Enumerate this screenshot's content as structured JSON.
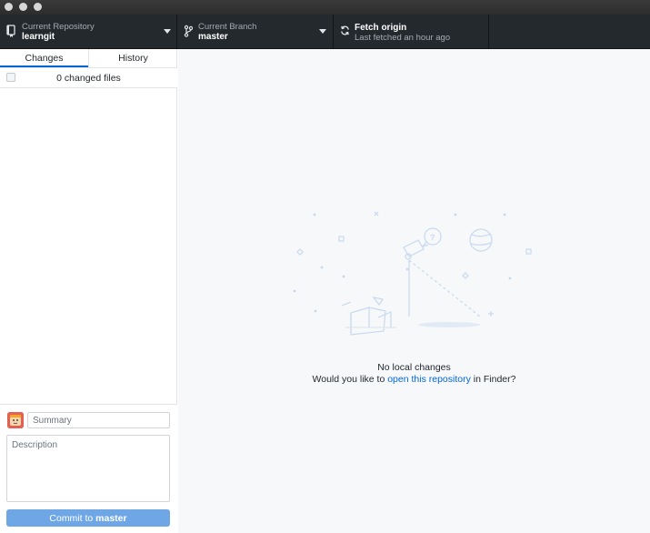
{
  "toolbar": {
    "repository": {
      "label": "Current Repository",
      "value": "learngit"
    },
    "branch": {
      "label": "Current Branch",
      "value": "master"
    },
    "fetch": {
      "label": "Fetch origin",
      "sub": "Last fetched an hour ago"
    }
  },
  "sidebar": {
    "tabs": [
      {
        "label": "Changes",
        "active": true
      },
      {
        "label": "History",
        "active": false
      }
    ],
    "changed_files": "0 changed files"
  },
  "commit": {
    "summary_placeholder": "Summary",
    "description_placeholder": "Description",
    "button_prefix": "Commit to ",
    "button_branch": "master"
  },
  "main": {
    "title": "No local changes",
    "prompt_before": "Would you like to ",
    "prompt_link": "open this repository",
    "prompt_after": " in Finder?"
  },
  "colors": {
    "toolbar_bg": "#24292e",
    "accent": "#0366d6",
    "commit_button": "#6fa7e6",
    "main_bg": "#f6f8fa"
  }
}
